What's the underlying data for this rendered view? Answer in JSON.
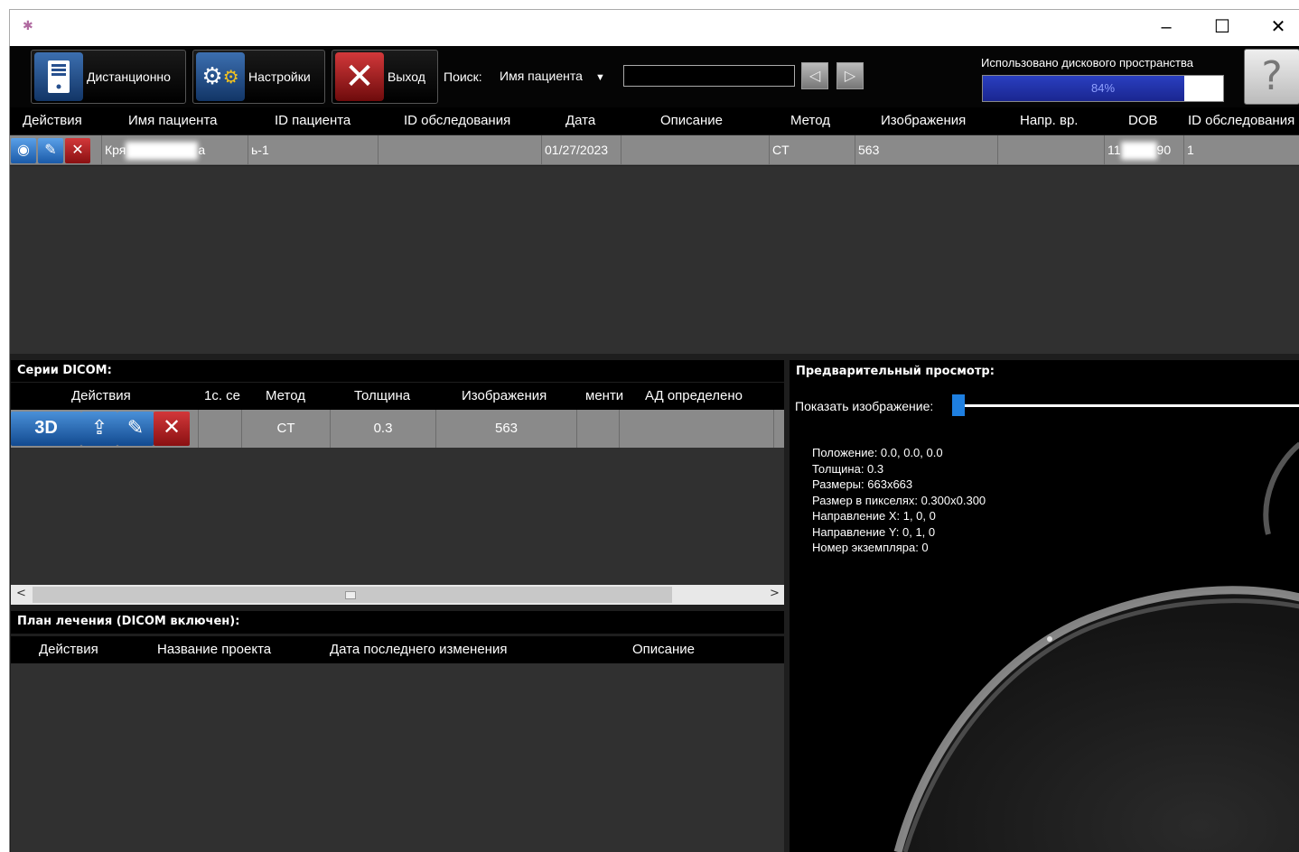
{
  "window": {
    "minimize": "–",
    "maximize": "☐",
    "close": "✕"
  },
  "toolbar": {
    "remote_label": "Дистанционно",
    "settings_label": "Настройки",
    "exit_label": "Выход",
    "search_label": "Поиск:",
    "search_field_selected": "Имя пациента",
    "search_value": "",
    "disk_label": "Использовано дискового пространства",
    "disk_percent_text": "84%",
    "disk_used_fraction": 0.84,
    "help": "?"
  },
  "patients": {
    "columns": [
      "Действия",
      "Имя пациента",
      "ID пациента",
      "ID обследования",
      "Дата",
      "Описание",
      "Метод",
      "Изображения",
      "Напр. вр.",
      "DOB",
      "ID обследования"
    ],
    "rows": [
      {
        "name_start": "Кря",
        "name_end": "а",
        "patient_id": "ь-1",
        "study_id": "",
        "date": "01/27/2023",
        "description": "",
        "modality": "CT",
        "images": "563",
        "referring": "",
        "dob_start": "11",
        "dob_end": "90",
        "study_id2": "1"
      }
    ]
  },
  "series": {
    "title": "Серии DICOM:",
    "columns": [
      "Действия",
      "1с. се",
      "Метод",
      "Толщина",
      "Изображения",
      "менти",
      "АД определено"
    ],
    "rows": [
      {
        "btn3d": "3D",
        "num": "",
        "modality": "CT",
        "thickness": "0.3",
        "images": "563",
        "comment": "",
        "ad": ""
      }
    ],
    "scroll_left": "<",
    "scroll_right": ">"
  },
  "plan": {
    "title": "План лечения (DICOM включен):",
    "columns": [
      "Действия",
      "Название проекта",
      "Дата последнего изменения",
      "Описание"
    ]
  },
  "preview": {
    "title": "Предварительный просмотр:",
    "show_image_label": "Показать изображение:",
    "info": [
      "Положение: 0.0, 0.0, 0.0",
      "Толщина: 0.3",
      "Размеры: 663x663",
      "Размер в пикселях: 0.300x0.300",
      "Направление X: 1, 0, 0",
      "Направление Y: 0, 1, 0",
      "Номер экземпляра: 0"
    ]
  }
}
